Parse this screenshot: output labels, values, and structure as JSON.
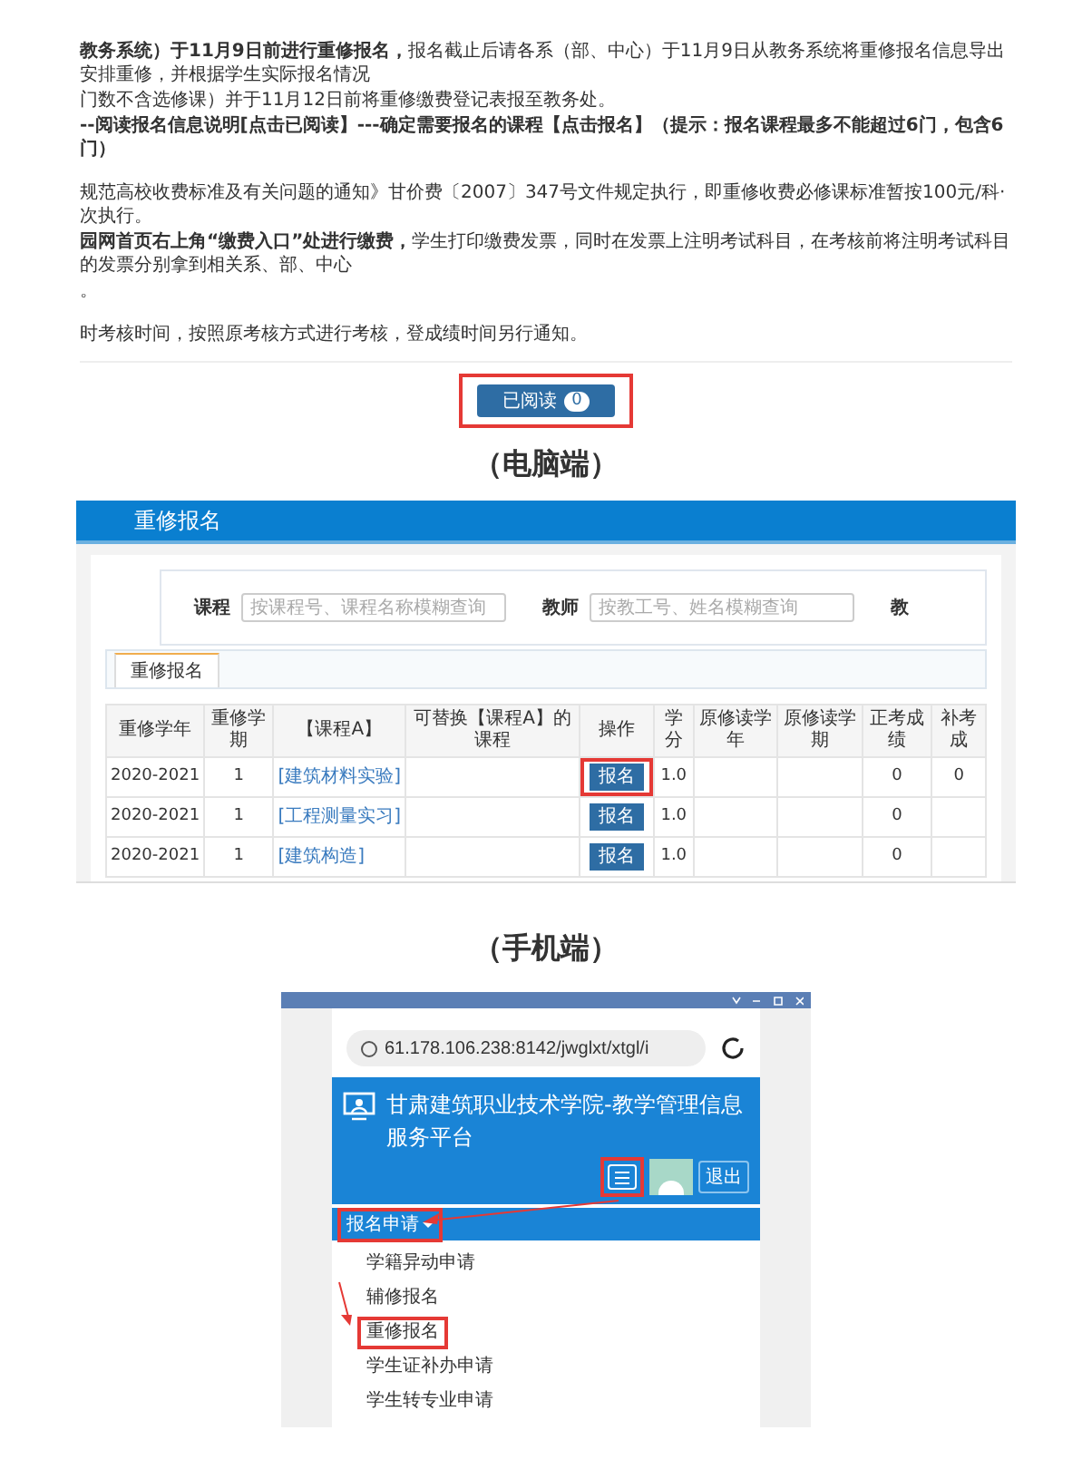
{
  "notice": {
    "paragraphs": [
      {
        "text": "**教务系统）于11月9日前进行重修报名，**报名截止后请各系（部、中心）于11月9日从教务系统将重修报名信息导出安排重修，并根据学生实际报名情况"
      },
      {
        "text": "门数不含选修课）并于11月12日前将重修缴费登记表报至教务处。"
      },
      {
        "text": "**--阅读报名信息说明[点击已阅读】---确定需要报名的课程【点击报名】（提示：报名课程最多不能超过6门，包含6门）**"
      },
      {
        "text": "规范高校收费标准及有关问题的通知》甘价费〔2007〕347号文件规定执行，即重修收费必修课标准暂按100元/科·次执行。",
        "gap_before": true
      },
      {
        "text": "**园网首页右上角“缴费入口”处进行缴费，**学生打印缴费发票，同时在发票上注明考试科目，在考核前将注明考试科目的发票分别拿到相关系、部、中心"
      },
      {
        "text": "。"
      },
      {
        "text": "时考核时间，按照原考核方式进行考核，登成绩时间另行通知。",
        "gap_before": true
      }
    ],
    "read_button": {
      "label": "已阅读",
      "count": "0",
      "highlighted": true
    }
  },
  "pc_caption": "（电脑端）",
  "pc": {
    "header": "重修报名",
    "filters": [
      {
        "label": "课程",
        "placeholder": "按课程号、课程名称模糊查询"
      },
      {
        "label": "教师",
        "placeholder": "按教工号、姓名模糊查询"
      },
      {
        "label": "教"
      }
    ],
    "tabs": [
      {
        "label": "重修报名",
        "selected": true
      }
    ],
    "table": {
      "columns": [
        "重修学年",
        "重修学期",
        "【课程A】",
        "可替换【课程A】的课程",
        "操作",
        "学分",
        "原修读学年",
        "原修读学期",
        "正考成绩",
        "补考成"
      ],
      "rows": [
        {
          "year": "2020-2021",
          "term": "1",
          "course": "[建筑材料实验]",
          "action": "报名",
          "highlighted": true,
          "credit": "1.0",
          "score": "0",
          "makeup": "0"
        },
        {
          "year": "2020-2021",
          "term": "1",
          "course": "[工程测量实习]",
          "action": "报名",
          "highlighted": false,
          "credit": "1.0",
          "score": "0"
        },
        {
          "year": "2020-2021",
          "term": "1",
          "course": "[建筑构造]",
          "action": "报名",
          "highlighted": false,
          "credit": "1.0",
          "score": "0"
        }
      ]
    }
  },
  "mobile_caption": "（手机端）",
  "mobile": {
    "url": "61.178.106.238:8142/jwglxt/xtgl/i",
    "title": "甘肃建筑职业技术学院-教学管理信息服务平台",
    "menu_highlighted": true,
    "logout": "退出",
    "menu": {
      "label": "报名申请",
      "expanded": true,
      "highlighted": true
    },
    "items": [
      {
        "label": "学籍异动申请",
        "highlighted": false
      },
      {
        "label": "辅修报名",
        "highlighted": false
      },
      {
        "label": "重修报名",
        "highlighted": true
      },
      {
        "label": "学生证补办申请",
        "highlighted": false
      },
      {
        "label": "学生转专业申请",
        "highlighted": false
      }
    ]
  }
}
